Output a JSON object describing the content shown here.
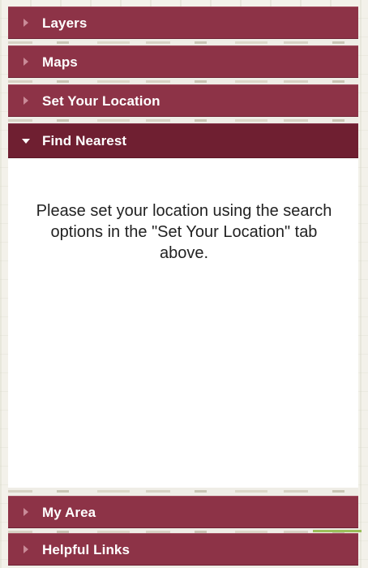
{
  "accordion": {
    "items": [
      {
        "label": "Layers",
        "expanded": false
      },
      {
        "label": "Maps",
        "expanded": false
      },
      {
        "label": "Set Your Location",
        "expanded": false
      },
      {
        "label": "Find Nearest",
        "expanded": true
      },
      {
        "label": "My Area",
        "expanded": false
      },
      {
        "label": "Helpful Links",
        "expanded": false
      }
    ]
  },
  "find_nearest": {
    "message": "Please set your location using the search options in the \"Set Your Location\" tab above."
  },
  "colors": {
    "header": "#8d3347",
    "header_active": "#6f1f31",
    "text_light": "#ffffff",
    "body_text": "#222222"
  },
  "icons": {
    "collapsed": "triangle-right-icon",
    "expanded": "triangle-down-icon"
  }
}
